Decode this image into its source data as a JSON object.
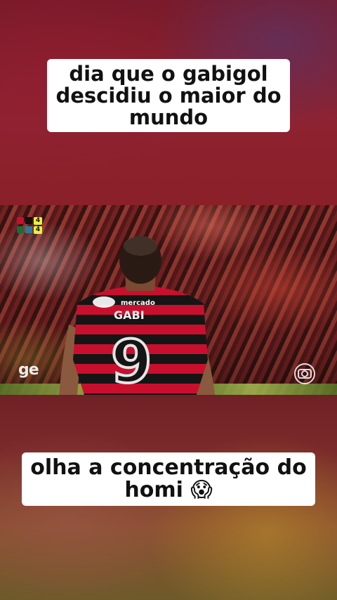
{
  "caption_top": {
    "lines": [
      "dia que o gabigol",
      "descidiu o maior do",
      "mundo"
    ]
  },
  "caption_bottom": {
    "line1": "olha a concentração do",
    "line2_text": "homi",
    "line2_emoji": "😱"
  },
  "video": {
    "scoreboard": {
      "home_score": "4",
      "away_score": "4",
      "home_color": "#c8102e",
      "away_color": "#1e6a3a"
    },
    "broadcaster_logo": "ge",
    "network_logo": "globo-icon",
    "jersey": {
      "name": "GABI",
      "number": "9",
      "sponsor": "mercado livre"
    }
  },
  "colors": {
    "caption_bg": "#ffffff",
    "caption_text": "#111111",
    "jersey_red": "#c8102e",
    "jersey_black": "#111111",
    "score_badge": "#e8f23a"
  }
}
